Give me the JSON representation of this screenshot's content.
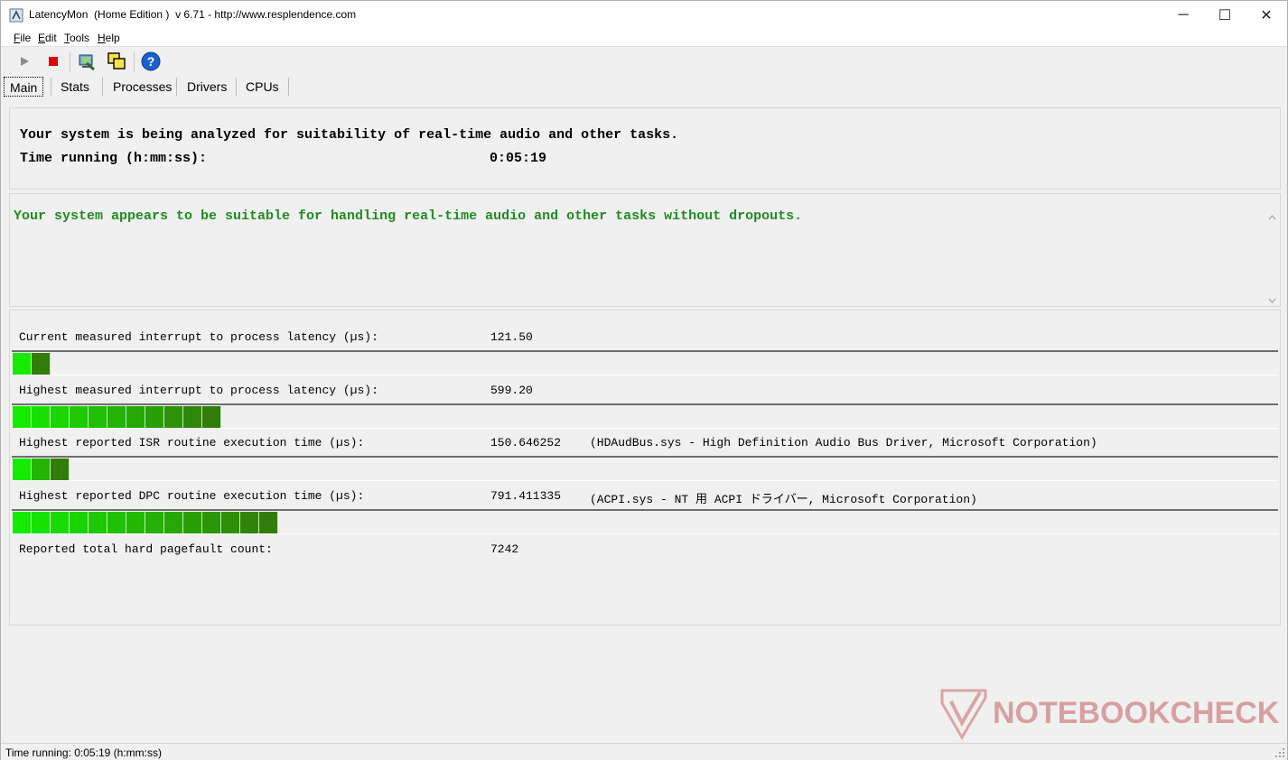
{
  "window": {
    "title": "LatencyMon  (Home Edition )  v 6.71 - http://www.resplendence.com",
    "controls": {
      "minimize": "─",
      "maximize": "☐",
      "close": "✕"
    }
  },
  "menu": [
    "File",
    "Edit",
    "Tools",
    "Help"
  ],
  "toolbar": {
    "icons": [
      "play-icon",
      "stop-icon",
      "analyze-icon",
      "windows-icon",
      "help-icon"
    ],
    "colors": {
      "stop": "#e00000",
      "help": "#1a5fd0"
    }
  },
  "tabs": [
    "Main",
    "Stats",
    "Processes",
    "Drivers",
    "CPUs"
  ],
  "analysis": {
    "line1": "Your system is being analyzed for suitability of real-time audio and other tasks.",
    "time_label": "Time running (h:mm:ss):",
    "time_value": "0:05:19"
  },
  "verdict": {
    "text": "Your system appears to be suitable for handling real-time audio and other tasks without dropouts.",
    "color": "#1f8c1f"
  },
  "metrics": [
    {
      "label": "Current measured interrupt to process latency (µs):",
      "value": "121.50",
      "detail": "",
      "bar_segments": 2
    },
    {
      "label": "Highest measured interrupt to process latency (µs):",
      "value": "599.20",
      "detail": "",
      "bar_segments": 11
    },
    {
      "label": "Highest reported ISR routine execution time (µs):",
      "value": "150.646252",
      "detail": "(HDAudBus.sys - High Definition Audio Bus Driver, Microsoft Corporation)",
      "bar_segments": 3
    },
    {
      "label": "Highest reported DPC routine execution time (µs):",
      "value": "791.411335",
      "detail": "(ACPI.sys - NT 用 ACPI ドライバー, Microsoft Corporation)",
      "bar_segments": 14
    },
    {
      "label": "Reported total hard pagefault count:",
      "value": "7242",
      "detail": ""
    }
  ],
  "statusbar": {
    "text": "Time running: 0:05:19  (h:mm:ss)"
  },
  "watermark": {
    "text": "NOTEBOOKCHECK"
  }
}
